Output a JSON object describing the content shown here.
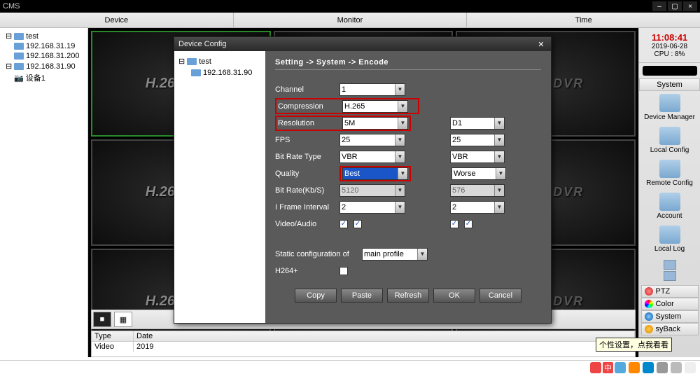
{
  "app_title": "CMS",
  "tabs": {
    "device": "Device",
    "monitor": "Monitor",
    "time": "Time"
  },
  "tree": {
    "root": "test",
    "n1": "192.168.31.19",
    "n2": "192.168.31.200",
    "n3": "192.168.31.90",
    "n4": "设备1"
  },
  "cell_text": "H.264 DVR",
  "clock": {
    "time": "11:08:41",
    "date": "2019-06-28",
    "cpu": "CPU : 8%"
  },
  "rpanel": {
    "system_hdr": "System",
    "items": [
      "Device Manager",
      "Local Config",
      "Remote Config",
      "Account",
      "Local Log"
    ],
    "ptz": "PTZ",
    "color": "Color",
    "system": "System",
    "playback": "syBack"
  },
  "log": {
    "headers": [
      "Type",
      "Date"
    ],
    "row": [
      "Video",
      "2019"
    ]
  },
  "modal": {
    "title": "Device Config",
    "tree_root": "test",
    "tree_child": "192.168.31.90",
    "breadcrumb": "Setting -> System -> Encode",
    "labels": {
      "channel": "Channel",
      "compression": "Compression",
      "resolution": "Resolution",
      "fps": "FPS",
      "bitratetype": "Bit Rate Type",
      "quality": "Quality",
      "bitrate": "Bit Rate(Kb/S)",
      "iframe": "I Frame Interval",
      "va": "Video/Audio",
      "static": "Static configuration of",
      "h264p": "H264+"
    },
    "values": {
      "channel": "1",
      "compression": "H.265",
      "resolution": "5M",
      "fps": "25",
      "bitratetype": "VBR",
      "quality": "Best",
      "bitrate": "5120",
      "iframe": "2",
      "resolution2": "D1",
      "fps2": "25",
      "bitratetype2": "VBR",
      "quality2": "Worse",
      "bitrate2": "576",
      "iframe2": "2",
      "static": "main profile"
    },
    "buttons": {
      "copy": "Copy",
      "paste": "Paste",
      "refresh": "Refresh",
      "ok": "OK",
      "cancel": "Cancel"
    }
  },
  "tooltip": "个性设置，点我看看",
  "ime": "中"
}
